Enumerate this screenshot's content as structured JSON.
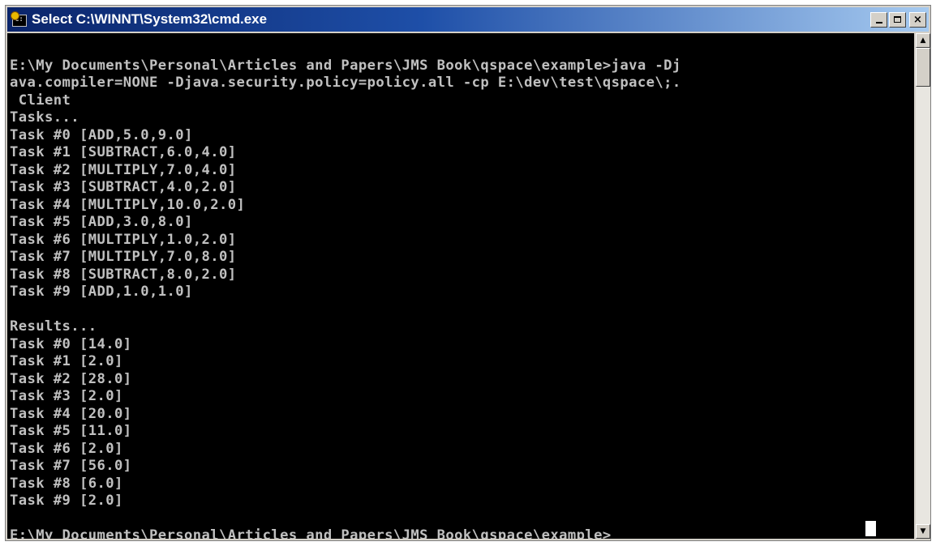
{
  "window": {
    "title": "Select C:\\WINNT\\System32\\cmd.exe",
    "icon": "cmd-icon",
    "buttons": {
      "minimize": "minimize-icon",
      "maximize": "maximize-icon",
      "close": "×"
    }
  },
  "console": {
    "lines": [
      "",
      "E:\\My Documents\\Personal\\Articles and Papers\\JMS Book\\qspace\\example>java -Dj",
      "ava.compiler=NONE -Djava.security.policy=policy.all -cp E:\\dev\\test\\qspace\\;.",
      " Client",
      "Tasks...",
      "Task #0 [ADD,5.0,9.0]",
      "Task #1 [SUBTRACT,6.0,4.0]",
      "Task #2 [MULTIPLY,7.0,4.0]",
      "Task #3 [SUBTRACT,4.0,2.0]",
      "Task #4 [MULTIPLY,10.0,2.0]",
      "Task #5 [ADD,3.0,8.0]",
      "Task #6 [MULTIPLY,1.0,2.0]",
      "Task #7 [MULTIPLY,7.0,8.0]",
      "Task #8 [SUBTRACT,8.0,2.0]",
      "Task #9 [ADD,1.0,1.0]",
      "",
      "Results...",
      "Task #0 [14.0]",
      "Task #1 [2.0]",
      "Task #2 [28.0]",
      "Task #3 [2.0]",
      "Task #4 [20.0]",
      "Task #5 [11.0]",
      "Task #6 [2.0]",
      "Task #7 [56.0]",
      "Task #8 [6.0]",
      "Task #9 [2.0]",
      "",
      "E:\\My Documents\\Personal\\Articles and Papers\\JMS Book\\qspace\\example>"
    ]
  },
  "colors": {
    "titlebar_start": "#0a246a",
    "titlebar_end": "#a6caf0",
    "console_bg": "#000000",
    "console_fg": "#c0c0c0"
  }
}
